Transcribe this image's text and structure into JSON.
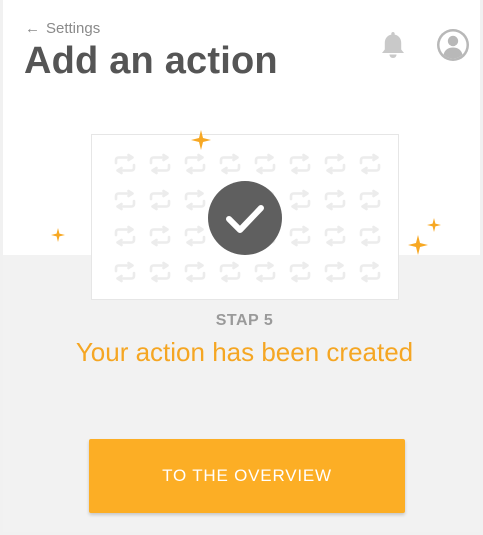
{
  "header": {
    "back_label": "Settings",
    "title": "Add an action",
    "icons": {
      "notifications": "bell-icon",
      "profile": "user-avatar-icon"
    }
  },
  "card": {
    "pattern_icon": "repeat-arrows-icon",
    "status_icon": "checkmark-icon",
    "decoration_icon": "sparkle-icon"
  },
  "step": {
    "label": "STAP 5",
    "message": "Your action has been created"
  },
  "cta": {
    "label": "TO THE OVERVIEW"
  },
  "colors": {
    "accent": "#fcae25",
    "message": "#f5a623",
    "check_circle": "#5f5f5f",
    "title": "#555555"
  }
}
